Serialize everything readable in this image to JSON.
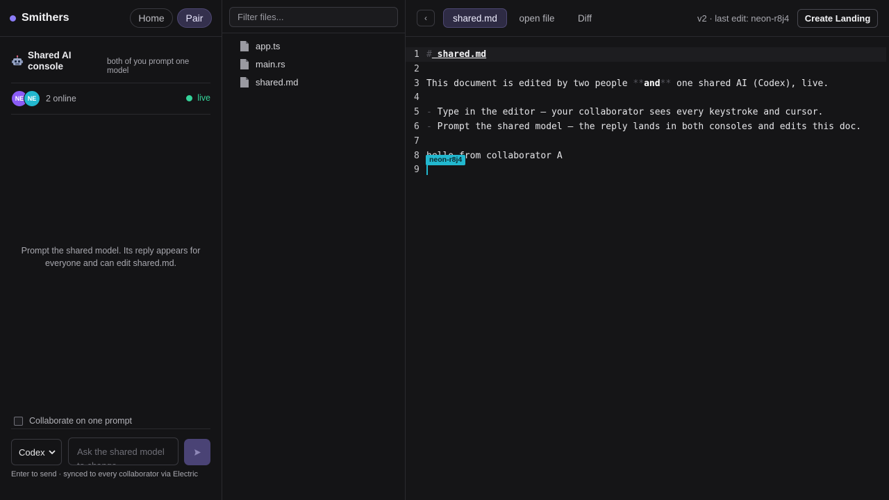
{
  "sidebar": {
    "brand": "Smithers",
    "nav": {
      "home_label": "Home",
      "pair_label": "Pair"
    },
    "console": {
      "title": "Shared AI console",
      "subtitle": "both of you prompt one model",
      "icon": "robot-icon"
    },
    "presence": {
      "avatars": [
        "NE",
        "NE"
      ],
      "online_text": "2 online",
      "live_label": "live"
    },
    "empty_message": "Prompt the shared model. Its reply appears for everyone and can edit shared.md.",
    "collab_label": "Collaborate on one prompt",
    "collab_checked": false,
    "model_select": {
      "value": "Codex",
      "options": [
        "Codex"
      ]
    },
    "prompt_placeholder": "Ask the shared model to change…",
    "hint": "Enter to send · synced to every collaborator via Electric"
  },
  "filetree": {
    "filter_placeholder": "Filter files...",
    "files": [
      "app.ts",
      "main.rs",
      "shared.md"
    ]
  },
  "editor": {
    "back_label": "‹",
    "tabs": [
      "shared.md",
      "open file",
      "Diff"
    ],
    "version_text": "v2 · last edit: neon-r8j4",
    "create_landing_label": "Create Landing",
    "line_numbers": [
      "1",
      "2",
      "3",
      "4",
      "5",
      "6",
      "7",
      "8",
      "9"
    ],
    "line1": {
      "mark": "#",
      "heading": " shared.md"
    },
    "line3": {
      "before": "This document is edited by two people ",
      "bold_open": "**",
      "bold": "and",
      "bold_close": "**",
      "after": " one shared AI (Codex), live."
    },
    "line5": {
      "mark": "-",
      "text": " Type in the editor — your collaborator sees every keystroke and cursor."
    },
    "line6": {
      "mark": "-",
      "text": " Prompt the shared model — the reply lands in both consoles and edits this doc."
    },
    "line8": "hello from collaborator A",
    "cursor_label": "neon-r8j4"
  },
  "colors": {
    "accent": "#8b7cf6",
    "live": "#34d399",
    "cursor": "#22b8cf",
    "avatar_1": "#8b5cf6",
    "avatar_2": "#22b8cf"
  }
}
